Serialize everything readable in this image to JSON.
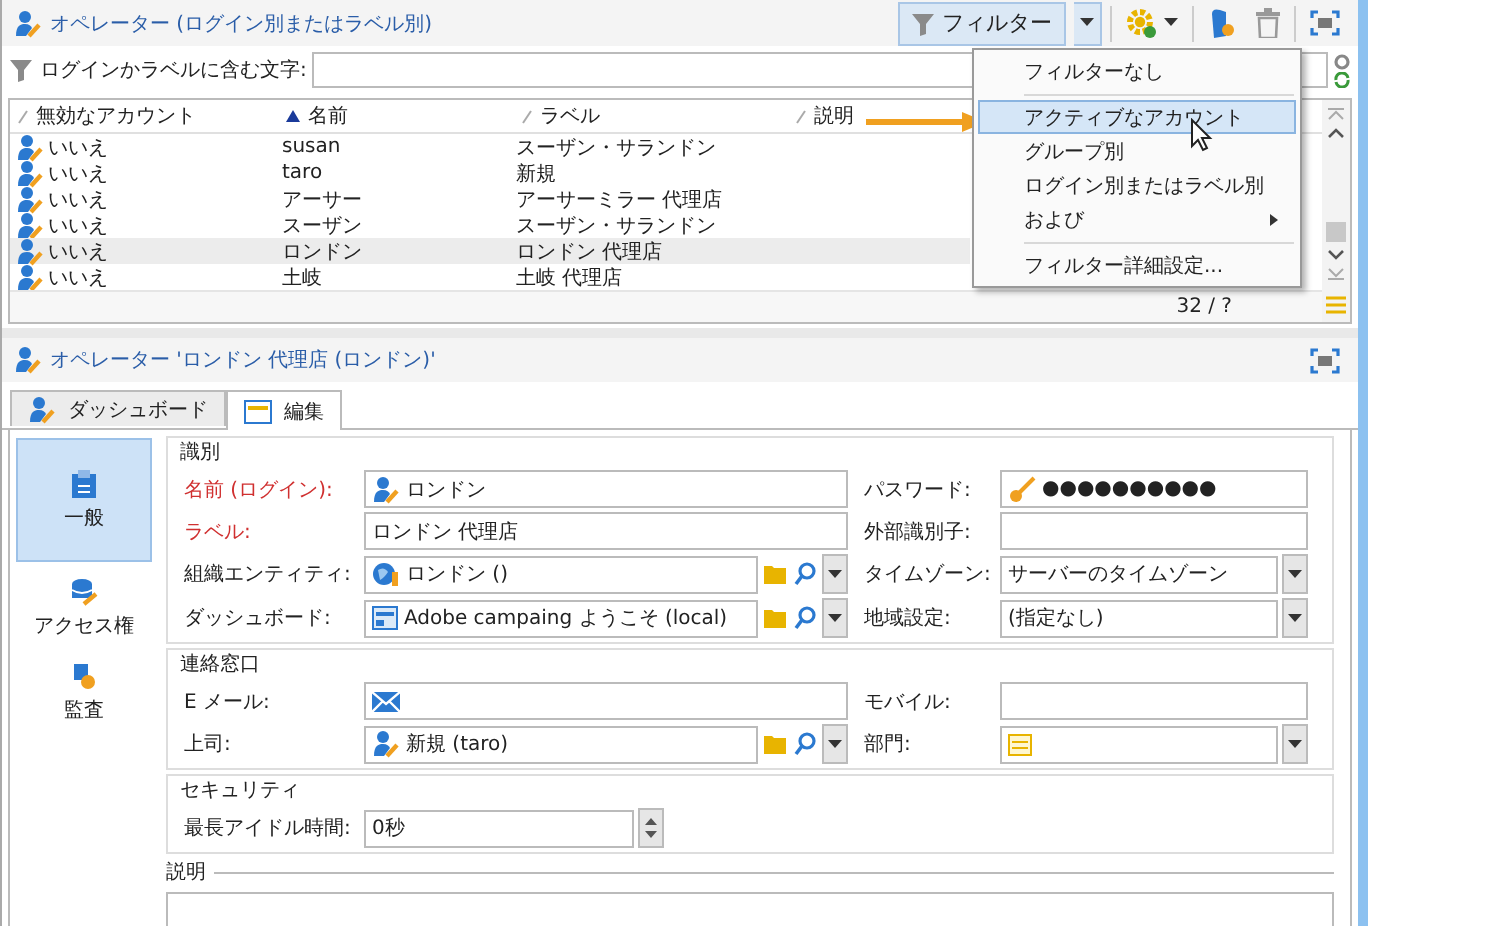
{
  "list_panel": {
    "title": "オペレーター (ログイン別またはラベル別)",
    "filter_button": "フィルター",
    "search_label": "ログインかラベルに含む文字:",
    "columns": [
      {
        "label": "無効なアカウント",
        "sorted": false
      },
      {
        "label": "名前",
        "sorted": true
      },
      {
        "label": "ラベル",
        "sorted": false
      },
      {
        "label": "説明",
        "sorted": false
      }
    ],
    "rows": [
      {
        "cells": [
          "いいえ",
          "susan",
          "スーザン・サランドン"
        ],
        "selected": false
      },
      {
        "cells": [
          "いいえ",
          "taro",
          "新規"
        ],
        "selected": false
      },
      {
        "cells": [
          "いいえ",
          "アーサー",
          "アーサーミラー 代理店"
        ],
        "selected": false
      },
      {
        "cells": [
          "いいえ",
          "スーザン",
          "スーザン・サランドン"
        ],
        "selected": false
      },
      {
        "cells": [
          "いいえ",
          "ロンドン",
          "ロンドン 代理店"
        ],
        "selected": true
      },
      {
        "cells": [
          "いいえ",
          "土岐",
          "土岐 代理店"
        ],
        "selected": false
      }
    ],
    "count": "32 / ?"
  },
  "filter_menu": {
    "items": [
      {
        "label": "フィルターなし",
        "selected": false,
        "submenu": false,
        "separator_after": true
      },
      {
        "label": "アクティブなアカウント",
        "selected": true,
        "submenu": false,
        "separator_after": false
      },
      {
        "label": "グループ別",
        "selected": false,
        "submenu": false,
        "separator_after": false
      },
      {
        "label": "ログイン別またはラベル別",
        "selected": false,
        "submenu": false,
        "separator_after": false
      },
      {
        "label": "および",
        "selected": false,
        "submenu": true,
        "separator_after": true
      },
      {
        "label": "フィルター詳細設定...",
        "selected": false,
        "submenu": false,
        "separator_after": false
      }
    ]
  },
  "detail_panel": {
    "title": "オペレーター 'ロンドン 代理店 (ロンドン)'",
    "tabs": [
      {
        "label": "ダッシュボード",
        "selected": false
      },
      {
        "label": "編集",
        "selected": true
      }
    ],
    "sidebar": [
      {
        "label": "一般",
        "selected": true
      },
      {
        "label": "アクセス権",
        "selected": false
      },
      {
        "label": "監査",
        "selected": false
      }
    ],
    "sections": [
      {
        "title": "識別",
        "kind": "group",
        "fields": [
          {
            "label": "名前 (ログイン):",
            "required": true,
            "kind": "text",
            "value": "ロンドン"
          },
          {
            "label": "パスワード:",
            "required": false,
            "kind": "text",
            "value": "●●●●●●●●●●"
          },
          {
            "label": "ラベル:",
            "required": true,
            "kind": "text",
            "value": "ロンドン 代理店"
          },
          {
            "label": "外部識別子:",
            "required": false,
            "kind": "text"
          },
          {
            "label": "組織エンティティ:",
            "required": false,
            "kind": "link",
            "value": "ロンドン ()"
          },
          {
            "label": "タイムゾーン:",
            "required": false,
            "kind": "select",
            "value": "サーバーのタイムゾーン"
          },
          {
            "label": "ダッシュボード:",
            "required": false,
            "kind": "link",
            "value": "Adobe campaing ようこそ (local)"
          },
          {
            "label": "地域設定:",
            "required": false,
            "kind": "select",
            "value": "(指定なし)"
          }
        ]
      },
      {
        "title": "連絡窓口",
        "kind": "group",
        "fields": [
          {
            "label": "E メール:",
            "required": false,
            "kind": "text"
          },
          {
            "label": "モバイル:",
            "required": false,
            "kind": "text"
          },
          {
            "label": "上司:",
            "required": false,
            "kind": "link",
            "value": "新規 (taro)"
          },
          {
            "label": "部門:",
            "required": false,
            "kind": "select"
          }
        ]
      },
      {
        "title": "セキュリティ",
        "kind": "group",
        "fields": [
          {
            "label": "最長アイドル時間:",
            "required": false,
            "kind": "spin",
            "value": "0秒"
          }
        ]
      },
      {
        "title": "説明",
        "kind": "textarea"
      }
    ]
  }
}
